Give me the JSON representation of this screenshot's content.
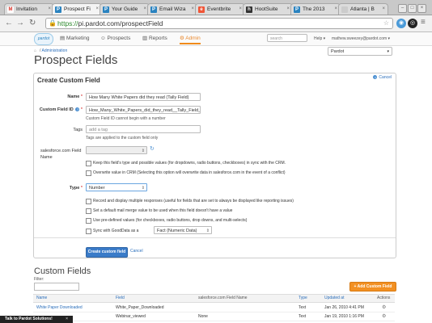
{
  "browser": {
    "tabs": [
      {
        "label": "Invitation",
        "icon": "gmail-icon",
        "color": "#d93025",
        "glyph": "M"
      },
      {
        "label": "Prospect Fi",
        "icon": "pardot-icon",
        "color": "#2a83c0",
        "glyph": "P",
        "active": true
      },
      {
        "label": "Your Guide",
        "icon": "pardot-icon",
        "color": "#2a83c0",
        "glyph": "P"
      },
      {
        "label": "Email Wiza",
        "icon": "pardot-icon",
        "color": "#2a83c0",
        "glyph": "P"
      },
      {
        "label": "Eventbrite",
        "icon": "eventbrite-icon",
        "color": "#f05537",
        "glyph": "e"
      },
      {
        "label": "HootSuite",
        "icon": "hootsuite-icon",
        "color": "#333333",
        "glyph": "h"
      },
      {
        "label": "The 2013",
        "icon": "pardot-icon",
        "color": "#2a83c0",
        "glyph": "P"
      },
      {
        "label": "Atlanta | B",
        "icon": "page-icon",
        "color": "#888888",
        "glyph": ""
      }
    ],
    "url_scheme": "https://",
    "url_rest": "pi.pardot.com/prospectField"
  },
  "appnav": {
    "logo": "pardot",
    "items": [
      "Marketing",
      "Prospects",
      "Reports",
      "Admin"
    ],
    "search_placeholder": "search",
    "help": "Help",
    "user": "mathew.sweezey@pardot.com"
  },
  "breadcrumb": {
    "link": "Administration"
  },
  "page": {
    "title": "Prospect Fields",
    "scope": "Pardot"
  },
  "form": {
    "title": "Create Custom Field",
    "cancel": "Cancel",
    "name_label": "Name",
    "name_value": "How Many White Papers did they read (Tally Field)",
    "id_label": "Custom Field ID",
    "id_value": "How_Many_White_Papers_did_they_read__Tally_Field_",
    "id_hint": "Custom Field ID cannot begin with a number",
    "tags_label": "Tags",
    "tags_placeholder": "add a tag",
    "tags_hint": "Tags are applied to the custom field only",
    "sf_label": "salesforce.com Field Name",
    "keep_sync": "Keep this field's type and possible values (for dropdowns, radio buttons, checkboxes) in sync with the CRM.",
    "overwrite": "Overwrite value in CRM (Selecting this option will overwrite data in salesforce.com in the event of a conflict)",
    "type_label": "Type",
    "type_value": "Number",
    "opt_multi": "Record and display multiple responses (useful for fields that are set to always be displayed like reporting issues)",
    "opt_default": "Set a default mail merge value to be used when this field doesn't have a value",
    "opt_predef": "Use pre-defined values (for checkboxes, radio buttons, drop downs, and multi-selects)",
    "opt_gooddata": "Sync with GoodData as a",
    "gooddata_value": "Fact (Numeric Data)",
    "submit": "Create custom field",
    "cancel_bottom": "Cancel"
  },
  "custom_fields": {
    "title": "Custom Fields",
    "filter_label": "Filter:",
    "add_button": "+ Add Custom Field",
    "columns": [
      "Name",
      "Field",
      "salesforce.com Field Name",
      "Type",
      "Updated at",
      "Actions"
    ],
    "rows": [
      [
        "White Paper Downloaded",
        "White_Paper_Downloaded",
        "",
        "Text",
        "Jan 26, 2010 4:41 PM"
      ],
      [
        "",
        "Webinar_viewed",
        "None",
        "Text",
        "Jan 19, 2010 1:16 PM"
      ]
    ]
  },
  "chat": {
    "label": "Talk to Pardot Solutions!"
  }
}
